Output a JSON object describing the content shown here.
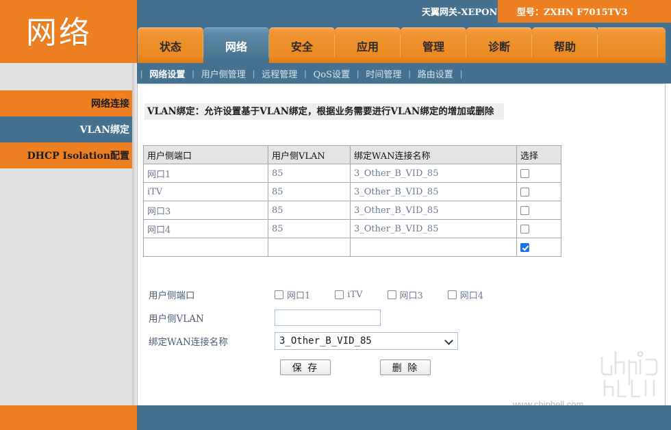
{
  "banner": {
    "brand_title": "网络",
    "gateway_name": "天翼网关-XEPON",
    "model_label": "型号：ZXHN F7015TV3"
  },
  "tabs": [
    {
      "label": "状态",
      "active": false
    },
    {
      "label": "网络",
      "active": true
    },
    {
      "label": "安全",
      "active": false
    },
    {
      "label": "应用",
      "active": false
    },
    {
      "label": "管理",
      "active": false
    },
    {
      "label": "诊断",
      "active": false
    },
    {
      "label": "帮助",
      "active": false
    }
  ],
  "subnav": [
    {
      "label": "网络设置",
      "active": true
    },
    {
      "label": "用户侧管理",
      "active": false
    },
    {
      "label": "远程管理",
      "active": false
    },
    {
      "label": "QoS设置",
      "active": false
    },
    {
      "label": "时间管理",
      "active": false
    },
    {
      "label": "路由设置",
      "active": false
    }
  ],
  "subnav_separator": "|",
  "sidebar": {
    "items": [
      {
        "label": "网络连接",
        "active": false
      },
      {
        "label": "VLAN绑定",
        "active": true
      },
      {
        "label": "DHCP Isolation配置",
        "active": false
      }
    ]
  },
  "main": {
    "page_description": "VLAN绑定：允许设置基于VLAN绑定，根据业务需要进行VLAN绑定的增加或删除",
    "table": {
      "headers": [
        "用户侧端口",
        "用户侧VLAN",
        "绑定WAN连接名称",
        "选择"
      ],
      "rows": [
        {
          "port": "网口1",
          "vlan": "85",
          "wan": "3_Other_B_VID_85",
          "selected": false
        },
        {
          "port": "iTV",
          "vlan": "85",
          "wan": "3_Other_B_VID_85",
          "selected": false
        },
        {
          "port": "网口3",
          "vlan": "85",
          "wan": "3_Other_B_VID_85",
          "selected": false
        },
        {
          "port": "网口4",
          "vlan": "85",
          "wan": "3_Other_B_VID_85",
          "selected": false
        },
        {
          "port": "",
          "vlan": "",
          "wan": "",
          "selected": true
        }
      ]
    },
    "form": {
      "port_label": "用户侧端口",
      "port_options": [
        {
          "label": "网口1",
          "checked": false
        },
        {
          "label": "iTV",
          "checked": false
        },
        {
          "label": "网口3",
          "checked": false
        },
        {
          "label": "网口4",
          "checked": false
        }
      ],
      "vlan_label": "用户侧VLAN",
      "vlan_value": "",
      "vlan_placeholder": "",
      "wan_label": "绑定WAN连接名称",
      "wan_selected": "3_Other_B_VID_85",
      "save_button": "保 存",
      "delete_button": "删 除"
    }
  },
  "watermark": {
    "url_text": "www.chiphell.com"
  },
  "colors": {
    "orange": "#ee8022",
    "blue": "#44718f",
    "accent_checkbox": "#1a73e8",
    "table_header_bg": "#e4e4e4"
  }
}
